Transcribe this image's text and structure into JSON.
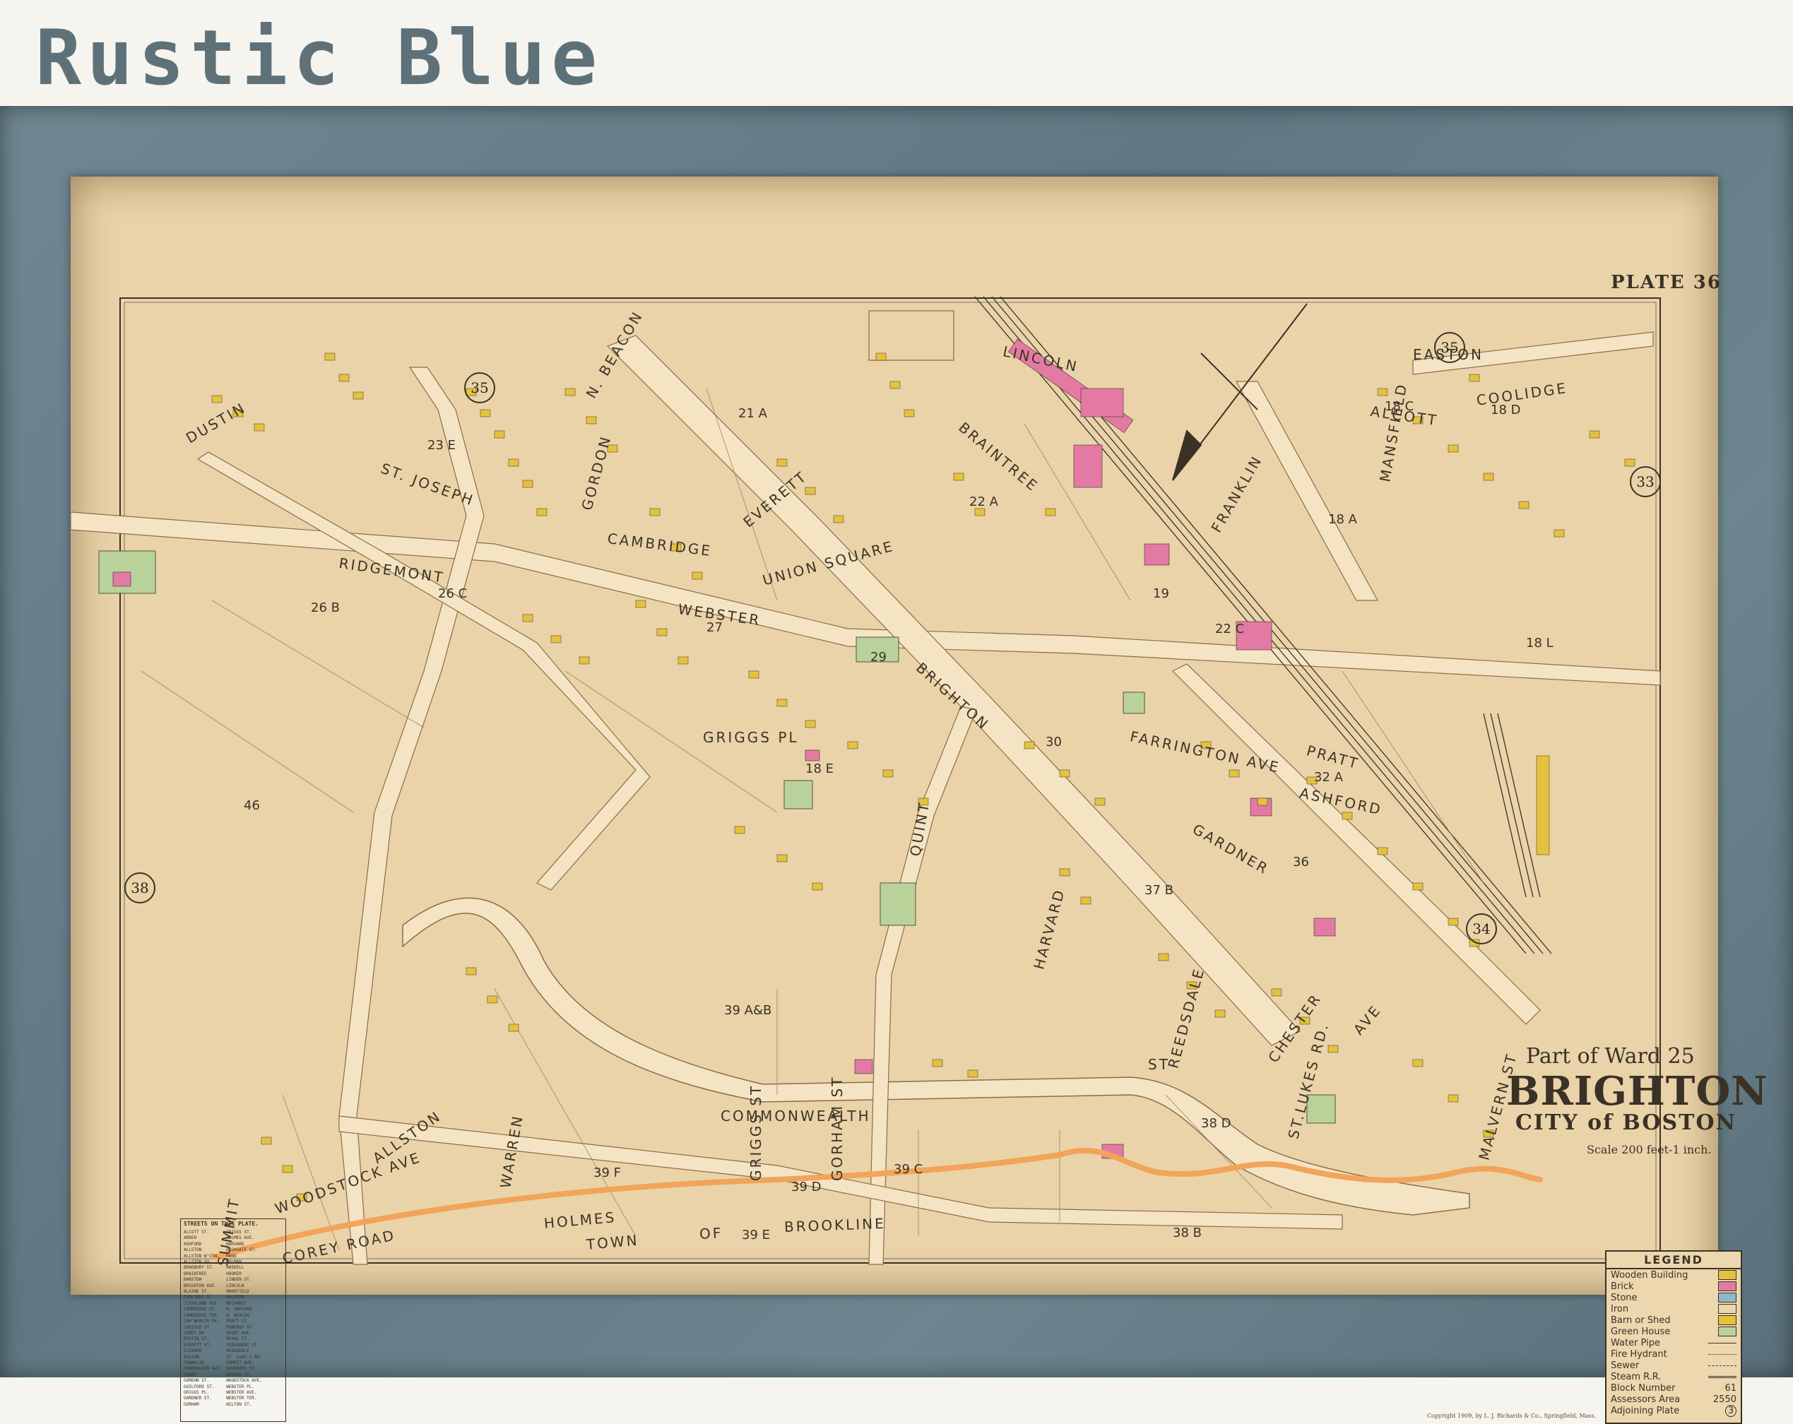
{
  "heading": "Rustic Blue",
  "map": {
    "plate": "PLATE 36",
    "ward": "Part of Ward 25",
    "title": "BRIGHTON",
    "city": "CITY of BOSTON",
    "scale": "Scale 200 feet-1 inch.",
    "copyright": "Copyright 1909, by L. J. Richards & Co., Springfield, Mass.",
    "colors": {
      "paper": "#ead3a9",
      "road": "#f3e2bf",
      "wooden": "#e4c23e",
      "brick": "#e37aa3",
      "stone": "#8fb7c7",
      "green": "#b9d29a",
      "boundary": "#f2a45a",
      "frame": "#647d87"
    },
    "streets": [
      "CAMBRIDGE",
      "RIDGEMONT",
      "UNION SQUARE",
      "WEBSTER",
      "BRIGHTON",
      "N. BEACON",
      "EVERETT",
      "LINCOLN",
      "BRAINTREE",
      "ALCOTT",
      "COOLIDGE",
      "EASTON",
      "MANSFIELD",
      "FARRINGTON AVE",
      "PRATT",
      "GARDNER",
      "ASHFORD",
      "HARVARD",
      "CHESTER",
      "AVE",
      "COMMONWEALTH",
      "ALLSTON",
      "WARREN",
      "WOODSTOCK AVE",
      "HOLMES",
      "GORHAM ST",
      "GRIGGS ST",
      "TOWN",
      "OF",
      "BROOKLINE",
      "ST",
      "ST.LUKES RD.",
      "MALVERN ST",
      "COREY ROAD",
      "DUSTIN",
      "GORDON",
      "GRIGGS PL",
      "QUINT",
      "REEDSDALE",
      "FRANKLIN",
      "ST. JOSEPH",
      "SUMMIT"
    ],
    "blocks": [
      "23 E",
      "21 A",
      "22 A",
      "22 C",
      "19",
      "18 A",
      "18 L",
      "18 C",
      "18 D",
      "26 B",
      "26 C",
      "29",
      "30",
      "32 A",
      "46",
      "39 A&B",
      "39 F",
      "39 D",
      "39 C",
      "39 E",
      "38 B",
      "37 B",
      "38 D",
      "18 E",
      "27",
      "36"
    ],
    "adjoining_plates": [
      "35",
      "35",
      "33",
      "38",
      "34"
    ],
    "legend": {
      "title": "LEGEND",
      "items": [
        "Wooden Building",
        "Brick",
        "Stone",
        "Iron",
        "Barn or Shed",
        "Green House",
        "Water Pipe",
        "Fire Hydrant",
        "Sewer",
        "Steam R.R.",
        "Block Number",
        "Assessors Area",
        "Adjoining Plate"
      ],
      "block_number_value": "61",
      "assessors_value": "2550",
      "adjoining_value": "3"
    },
    "streets_on_plate": {
      "title": "STREETS ON THIS PLATE.",
      "col1": [
        "ALCOTT ST.",
        "ARDEN",
        "ASHFORD",
        "ALLSTON",
        "ALLSTON W'GTN.",
        "ALLSTON SQ.",
        "BRADBURY ST.",
        "BRAINTREE",
        "BARSTOW",
        "BRIGHTON AVE.",
        "BLAINE ST.",
        "COOLIDGE ST.",
        "CLEVELAND AVE.",
        "CAMBRIDGE ST.",
        "CAMBRIDGE TER.",
        "COM'WEALTH PK.",
        "CHESTER ST.",
        "COREY RD",
        "DUSTIN ST.",
        "EVERETT ST.",
        "ELEANOR",
        "EASTON",
        "FRANKLIN",
        "FARRINGTON AVE.",
        "GRANT",
        "GORDON ST.",
        "GUILFORD ST.",
        "GRIGGS PL.",
        "GARDNER ST.",
        "GORHAM"
      ],
      "col2": [
        "GRIGGS ST.",
        "HOLMES AVE.",
        "HARVARD",
        "HIGHGATE ST.",
        "HANO",
        "HOLMAN",
        "HASKELL",
        "HOOKER",
        "LINDEN ST.",
        "LINCOLN",
        "MANSFIELD",
        "MALVERN",
        "MECHANIC",
        "N. HARVARD",
        "N. BEACON",
        "PRATT ST.",
        "POMEROY ST.",
        "QUINT AVE.",
        "ROYAL ST.",
        "RIDGEMONT ST.",
        "REEDSDALE",
        "ST. LUKE'S RD.",
        "SUMMIT AVE.",
        "SAUNDERS ST.",
        "WARREN ST.",
        "WOODSTOCK AVE.",
        "WEBSTER PL.",
        "WEBSTER AVE.",
        "WEBSTER TER.",
        "WILTON ST."
      ]
    }
  }
}
